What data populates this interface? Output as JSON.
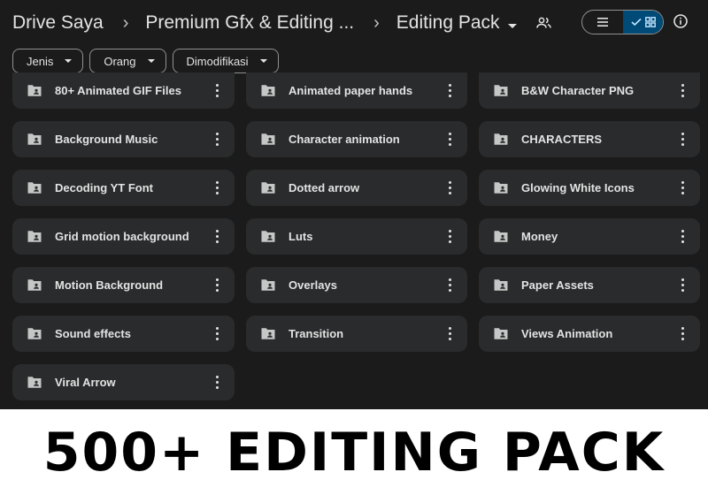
{
  "breadcrumb": {
    "root": "Drive Saya",
    "parent": "Premium Gfx & Editing ...",
    "current": "Editing Pack"
  },
  "filters": [
    {
      "label": "Jenis"
    },
    {
      "label": "Orang"
    },
    {
      "label": "Dimodifikasi"
    }
  ],
  "view": {
    "active": "grid"
  },
  "folders": [
    {
      "name": "80+ Animated GIF Files"
    },
    {
      "name": "Animated paper hands"
    },
    {
      "name": "B&W Character PNG"
    },
    {
      "name": "Background Music"
    },
    {
      "name": "Character animation"
    },
    {
      "name": "CHARACTERS"
    },
    {
      "name": "Decoding YT Font"
    },
    {
      "name": "Dotted arrow"
    },
    {
      "name": "Glowing White Icons"
    },
    {
      "name": "Grid motion background"
    },
    {
      "name": "Luts"
    },
    {
      "name": "Money"
    },
    {
      "name": "Motion Background"
    },
    {
      "name": "Overlays"
    },
    {
      "name": "Paper Assets"
    },
    {
      "name": "Sound effects"
    },
    {
      "name": "Transition"
    },
    {
      "name": "Views Animation"
    },
    {
      "name": "Viral Arrow"
    }
  ],
  "banner": {
    "text": "500+ EDITING PACK"
  },
  "colors": {
    "background": "#1b1b1b",
    "card": "#2a2b2c",
    "text": "#e3e3e3",
    "accent_toggle": "#004a77"
  }
}
